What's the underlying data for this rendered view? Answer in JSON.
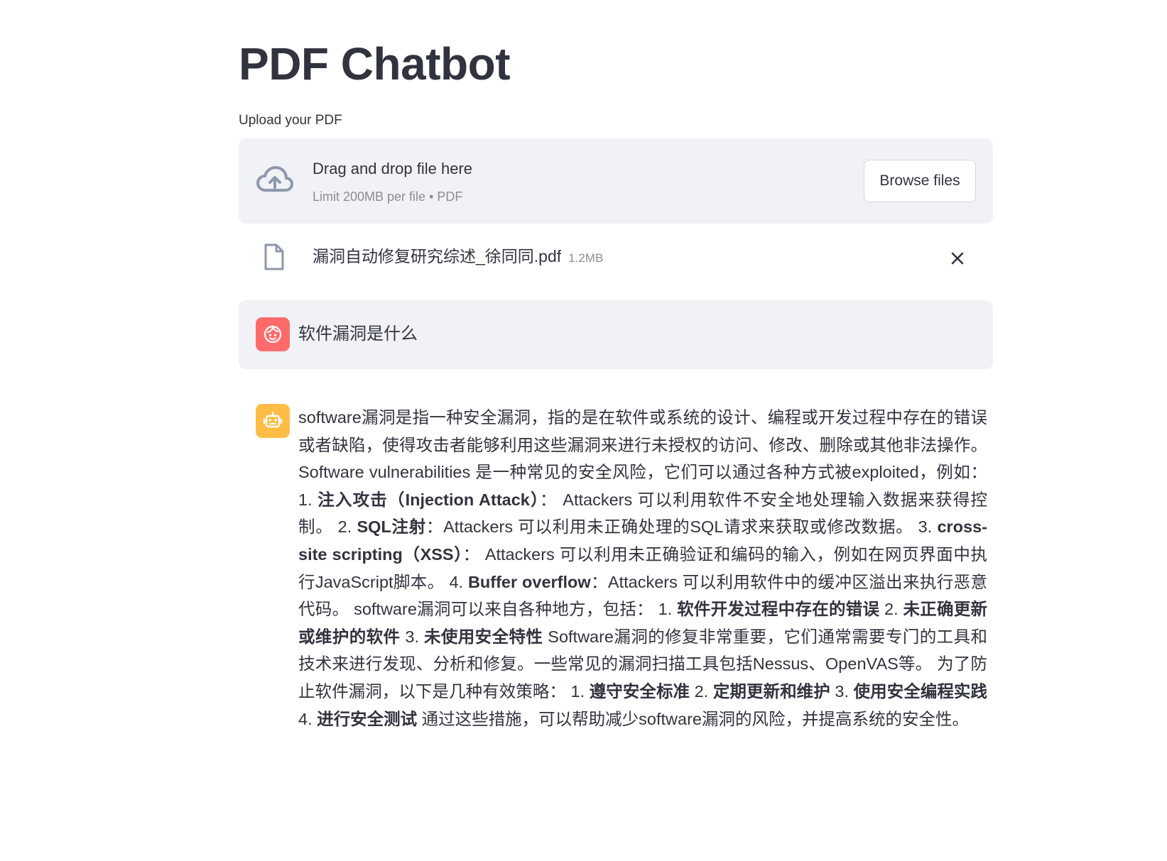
{
  "page": {
    "title": "PDF Chatbot"
  },
  "upload": {
    "label": "Upload your PDF",
    "dropzone_title": "Drag and drop file here",
    "dropzone_subtitle": "Limit 200MB per file • PDF",
    "browse_label": "Browse files",
    "icon": "cloud-upload-icon"
  },
  "file": {
    "name": "漏洞自动修复研究综述_徐同同.pdf",
    "size": "1.2MB",
    "icon": "file-icon",
    "remove_icon": "close-icon"
  },
  "chat": {
    "user_message": "软件漏洞是什么",
    "assistant_segments": [
      {
        "text": "software漏洞是指一种安全漏洞，指的是在软件或系统的设计、编程或开发过程中存在的错误或者缺陷，使得攻击者能够利用这些漏洞来进行未授权的访问、修改、删除或其他非法操作。 Software vulnerabilities 是一种常见的安全风险，它们可以通过各种方式被exploited，例如： 1. ",
        "bold": false
      },
      {
        "text": "注入攻击（Injection Attack）",
        "bold": true
      },
      {
        "text": "： Attackers 可以利用软件不安全地处理输入数据来获得控制。 2. ",
        "bold": false
      },
      {
        "text": "SQL注射",
        "bold": true
      },
      {
        "text": "：Attackers 可以利用未正确处理的SQL请求来获取或修改数据。 3. ",
        "bold": false
      },
      {
        "text": "cross-site scripting（XSS）",
        "bold": true
      },
      {
        "text": "： Attackers 可以利用未正确验证和编码的输入，例如在网页界面中执行JavaScript脚本。 4. ",
        "bold": false
      },
      {
        "text": "Buffer overflow",
        "bold": true
      },
      {
        "text": "：Attackers 可以利用软件中的缓冲区溢出来执行恶意代码。 software漏洞可以来自各种地方，包括： 1. ",
        "bold": false
      },
      {
        "text": "软件开发过程中存在的错误",
        "bold": true
      },
      {
        "text": " 2. ",
        "bold": false
      },
      {
        "text": "未正确更新或维护的软件",
        "bold": true
      },
      {
        "text": " 3. ",
        "bold": false
      },
      {
        "text": "未使用安全特性",
        "bold": true
      },
      {
        "text": " Software漏洞的修复非常重要，它们通常需要专门的工具和技术来进行发现、分析和修复。一些常见的漏洞扫描工具包括Nessus、OpenVAS等。 为了防止软件漏洞，以下是几种有效策略： 1. ",
        "bold": false
      },
      {
        "text": "遵守安全标准",
        "bold": true
      },
      {
        "text": " 2. ",
        "bold": false
      },
      {
        "text": "定期更新和维护",
        "bold": true
      },
      {
        "text": " 3. ",
        "bold": false
      },
      {
        "text": "使用安全编程实践",
        "bold": true
      },
      {
        "text": " 4. ",
        "bold": false
      },
      {
        "text": "进行安全测试",
        "bold": true
      },
      {
        "text": " 通过这些措施，可以帮助减少software漏洞的风险，并提高系统的安全性。",
        "bold": false
      }
    ]
  },
  "colors": {
    "text": "#31333f",
    "muted": "#8a8d96",
    "panel": "#f0f2f6",
    "user_avatar": "#ff6b6b",
    "assistant_avatar": "#ffbd45"
  }
}
